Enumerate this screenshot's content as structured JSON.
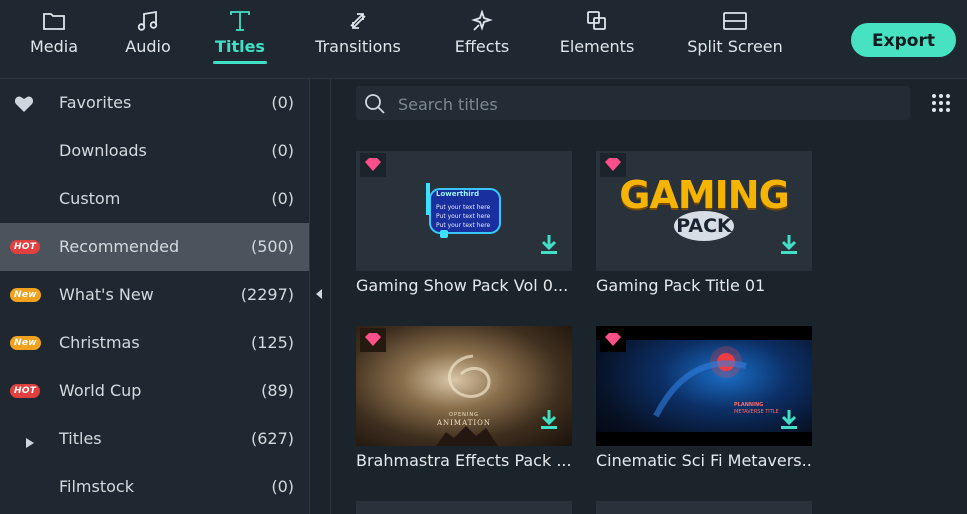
{
  "toolbar": {
    "tabs": [
      {
        "label": "Media",
        "icon": "folder-icon"
      },
      {
        "label": "Audio",
        "icon": "music-note-icon"
      },
      {
        "label": "Titles",
        "icon": "text-t-icon",
        "active": true
      },
      {
        "label": "Transitions",
        "icon": "transition-arrows-icon"
      },
      {
        "label": "Effects",
        "icon": "sparkle-icon"
      },
      {
        "label": "Elements",
        "icon": "layers-icon"
      },
      {
        "label": "Split Screen",
        "icon": "split-screen-icon"
      }
    ],
    "export_label": "Export",
    "accent": "#3fe0c5"
  },
  "sidebar": {
    "items": [
      {
        "label": "Favorites",
        "count": "(0)",
        "icon": "heart-icon"
      },
      {
        "label": "Downloads",
        "count": "(0)"
      },
      {
        "label": "Custom",
        "count": "(0)"
      },
      {
        "label": "Recommended",
        "count": "(500)",
        "badge": "HOT",
        "active": true
      },
      {
        "label": "What's New",
        "count": "(2297)",
        "badge": "New"
      },
      {
        "label": "Christmas",
        "count": "(125)",
        "badge": "New"
      },
      {
        "label": "World Cup",
        "count": "(89)",
        "badge": "HOT"
      },
      {
        "label": "Titles",
        "count": "(627)",
        "icon": "expand-triangle-icon"
      },
      {
        "label": "Filmstock",
        "count": "(0)"
      }
    ]
  },
  "search": {
    "placeholder": "Search titles",
    "value": ""
  },
  "cards": [
    {
      "title": "Gaming Show Pack Vol 0...",
      "thumb_text": {
        "heading": "Lowerthird",
        "lines": [
          "Put your text here",
          "Put your text here",
          "Put your text here"
        ]
      }
    },
    {
      "title": "Gaming Pack Title 01",
      "thumb_text": {
        "heading": "GAMING",
        "sub": "PACK"
      }
    },
    {
      "title": "Brahmastra Effects Pack ...",
      "thumb_text": {
        "heading": "OPENING",
        "sub": "ANIMATION"
      }
    },
    {
      "title": "Cinematic Sci Fi Metavers...",
      "thumb_text": {
        "heading": "PLANNING",
        "sub": "METAVERSE TITLE"
      }
    }
  ]
}
